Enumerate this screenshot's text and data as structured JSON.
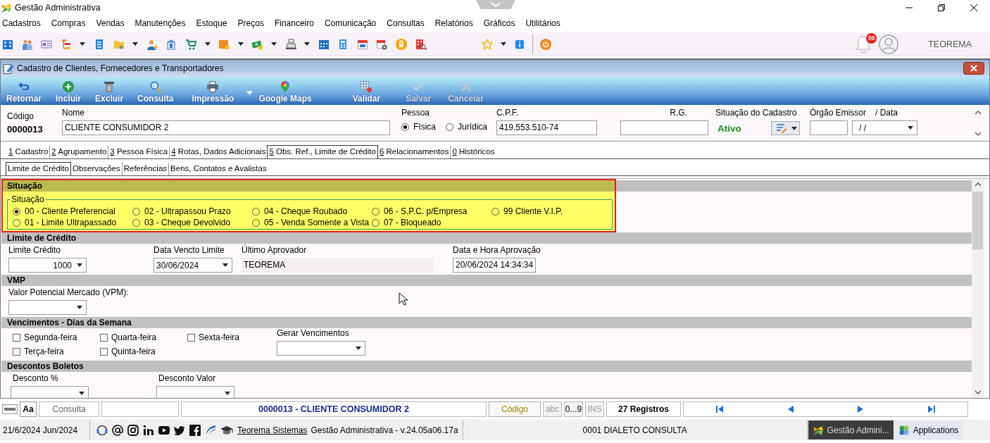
{
  "window": {
    "title": "Gestão Administrativa"
  },
  "menu": [
    "Cadastros",
    "Compras",
    "Vendas",
    "Manutenções",
    "Estoque",
    "Preços",
    "Financeiro",
    "Comunicação",
    "Consultas",
    "Relatórios",
    "Gráficos",
    "Utilitários"
  ],
  "toolbar": {
    "notifications": "00",
    "user": "TEOREMA"
  },
  "form": {
    "title": "Cadastro de Clientes, Fornecedores e Transportadores",
    "actions": [
      {
        "kind": "return",
        "label": "Retornar",
        "disabled": false,
        "dropdown": false
      },
      {
        "kind": "add",
        "label": "Incluir",
        "disabled": false,
        "dropdown": false
      },
      {
        "kind": "delete",
        "label": "Excluir",
        "disabled": false,
        "dropdown": false
      },
      {
        "kind": "search",
        "label": "Consulta",
        "disabled": false,
        "dropdown": false
      },
      {
        "kind": "print",
        "label": "Impressão",
        "disabled": false,
        "dropdown": true
      },
      {
        "kind": "map",
        "label": "Google Maps",
        "disabled": false,
        "dropdown": false
      },
      {
        "kind": "validate",
        "label": "Validar",
        "disabled": false,
        "dropdown": false
      },
      {
        "kind": "save",
        "label": "Salvar",
        "disabled": true,
        "dropdown": false
      },
      {
        "kind": "cancel",
        "label": "Cancelar",
        "disabled": true,
        "dropdown": false
      }
    ],
    "header": {
      "code": {
        "label": "Código",
        "value": "0000013"
      },
      "name": {
        "label": "Nome",
        "value": "CLIENTE CONSUMIDOR 2"
      },
      "person_type": {
        "label": "Pessoa",
        "options": [
          {
            "label": "Física",
            "selected": true
          },
          {
            "label": "Jurídica",
            "selected": false
          }
        ]
      },
      "cpf": {
        "label": "C.P.F.",
        "value": "419.553.510-74"
      },
      "rg": {
        "label": "R.G."
      },
      "status": {
        "label": "Situação do Cadastro",
        "value": "Ativo"
      },
      "issuer": {
        "label": "Órgão Emissor"
      },
      "date": {
        "label": "/ Data",
        "value": "/ /"
      }
    },
    "tabs": [
      {
        "key": "1",
        "label": "Cadastro",
        "selected": false
      },
      {
        "key": "2",
        "label": "Agrupamento",
        "selected": false
      },
      {
        "key": "3",
        "label": "Pessoa Física",
        "selected": false
      },
      {
        "key": "4",
        "label": "Rotas, Dados Adicionais",
        "selected": false
      },
      {
        "key": "5",
        "label": "Obs. Ref., Limite de Crédito",
        "selected": true
      },
      {
        "key": "6",
        "label": "Relacionamentos",
        "selected": false
      },
      {
        "key": "0",
        "label": "Históricos",
        "selected": false
      }
    ],
    "subtabs": [
      {
        "label": "Limite de Crédito",
        "selected": true
      },
      {
        "label": "Observações",
        "selected": false
      },
      {
        "label": "Referências",
        "selected": false
      },
      {
        "label": "Bens, Contatos e Avalistas",
        "selected": false
      }
    ],
    "situacao": {
      "title": "Situação",
      "highlighted": true,
      "group_title": "Situação",
      "options": [
        {
          "label": "00 - Cliente Preferencial",
          "selected": true
        },
        {
          "label": "02 - Ultrapassou Prazo",
          "selected": false
        },
        {
          "label": "04 - Cheque Roubado",
          "selected": false
        },
        {
          "label": "06 - S.P.C. p/Empresa",
          "selected": false
        },
        {
          "label": "99 Cliente V.I.P.",
          "selected": false
        },
        {
          "label": "01 - Limite Ultrapassado",
          "selected": false
        },
        {
          "label": "03 - Cheque Devolvido",
          "selected": false
        },
        {
          "label": "05 - Venda Somente a Vista",
          "selected": false
        },
        {
          "label": "07 - Bloqueado",
          "selected": false
        }
      ]
    },
    "credit_limit": {
      "title": "Limite de Crédito",
      "fields": [
        {
          "kind": "number",
          "label": "Limite Crédito",
          "value": "1000"
        },
        {
          "kind": "combo",
          "label": "Data Vencto Limite",
          "value": "30/06/2024"
        },
        {
          "kind": "readonly",
          "label": "Último Aprovador",
          "value": "TEOREMA"
        },
        {
          "kind": "input",
          "label": "Data e Hora Aprovação",
          "value": "20/06/2024 14:34:34"
        }
      ]
    },
    "vmp": {
      "title": "VMP",
      "fields": [
        {
          "kind": "combo",
          "label": "Valor Potencial Mercado (VPM):"
        }
      ]
    },
    "due_days": {
      "title": "Vencimentos - Dias da Semana",
      "days": [
        {
          "label": "Segunda-feira",
          "checked": false
        },
        {
          "label": "Terça-feira",
          "checked": false
        },
        {
          "label": "Quarta-feira",
          "checked": false
        },
        {
          "label": "Quinta-feira",
          "checked": false
        },
        {
          "label": "Sexta-feira",
          "checked": false
        }
      ],
      "generate": {
        "kind": "combo",
        "label": "Gerar Vencimentos"
      }
    },
    "discounts": {
      "title": "Descontos Boletos",
      "fields": [
        {
          "kind": "combo",
          "label": "Desconto %"
        },
        {
          "kind": "combo",
          "label": "Desconto Valor"
        }
      ]
    }
  },
  "status_bar": {
    "font_button": "Aa",
    "mode": "Consulta",
    "record": "0000013 - CLIENTE CONSUMIDOR 2",
    "order": "Código",
    "indicators": [
      {
        "label": "abc",
        "active": false
      },
      {
        "label": "0...9",
        "active": true
      },
      {
        "label": "INS",
        "active": false
      }
    ],
    "count": "27 Registros"
  },
  "bottom_bar": {
    "date": "21/6/2024 Jun/2024",
    "link": "Teorema Sistemas",
    "version": "Gestão Administrativa - v.24.05a06.17a",
    "database": "0001 DIALETO CONSULTA",
    "taskbar": [
      {
        "label": "Gestão Admini...",
        "selected": true
      },
      {
        "label": "Applications",
        "selected": false
      }
    ]
  }
}
